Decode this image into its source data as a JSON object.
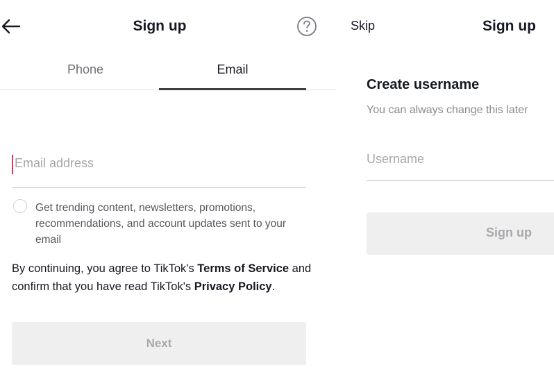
{
  "left_screen": {
    "header": {
      "title": "Sign up",
      "back_icon": "arrow-left-icon",
      "help_icon": "question-circle-icon"
    },
    "tabs": [
      {
        "label": "Phone",
        "active": false
      },
      {
        "label": "Email",
        "active": true
      }
    ],
    "email_input": {
      "value": "",
      "placeholder": "Email address"
    },
    "optin": {
      "checked": false,
      "text": "Get trending content, newsletters, promotions, recommendations, and account updates sent to your email"
    },
    "legal": {
      "prefix": "By continuing, you agree to TikTok's ",
      "terms_link": "Terms of Service",
      "middle": " and confirm that you have read TikTok's ",
      "privacy_link": "Privacy Policy",
      "suffix": "."
    },
    "next_button": {
      "label": "Next",
      "enabled": false
    }
  },
  "right_screen": {
    "header": {
      "skip_label": "Skip",
      "title": "Sign up"
    },
    "heading": "Create username",
    "subtext": "You can always change this later",
    "username_input": {
      "value": "",
      "placeholder": "Username"
    },
    "signup_button": {
      "label": "Sign up",
      "enabled": false
    }
  },
  "colors": {
    "accent_caret": "#fe2c55",
    "text_primary": "#161823",
    "disabled_button_bg": "#efefef",
    "disabled_button_text": "#a8a9ad"
  }
}
